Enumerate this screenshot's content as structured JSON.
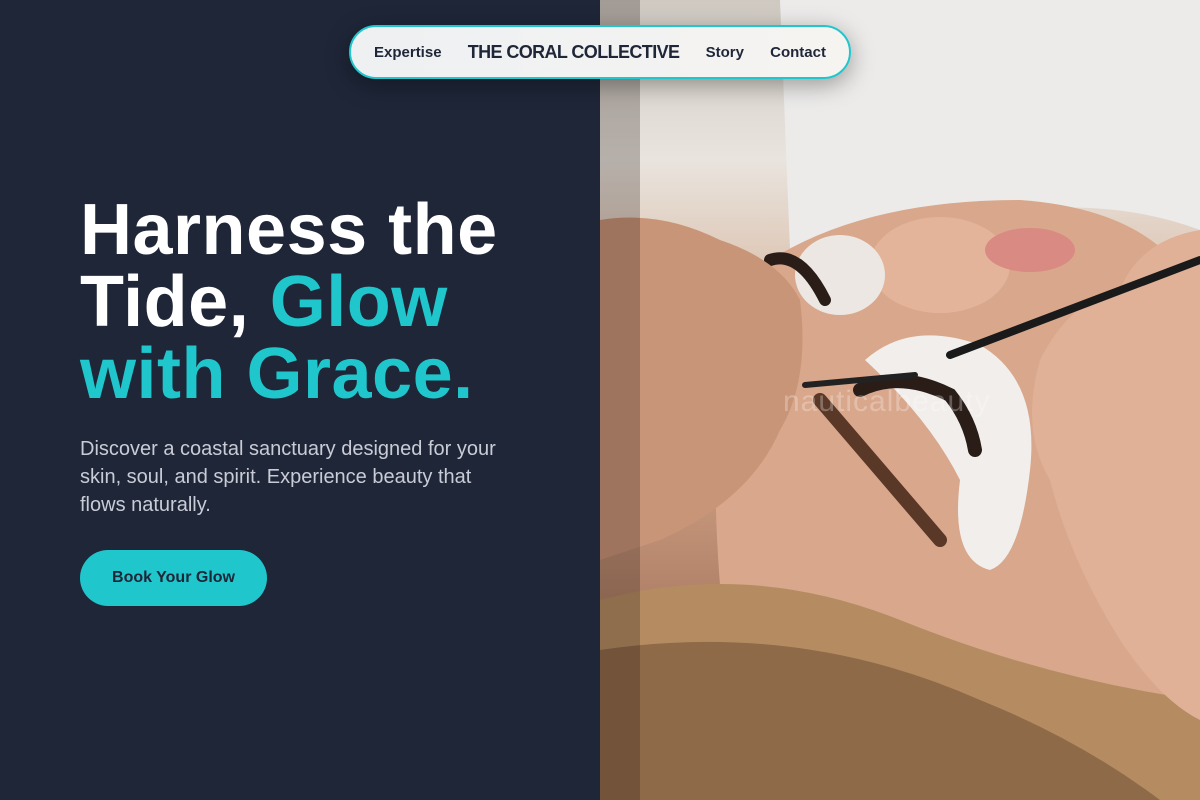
{
  "nav": {
    "left_link": "Expertise",
    "brand": "THE CORAL COLLECTIVE",
    "right_links": [
      "Story",
      "Contact"
    ]
  },
  "hero": {
    "title_line1": "Harness the",
    "title_line2_plain": "Tide, ",
    "title_line2_accent": "Glow",
    "title_line3_accent": "with Grace.",
    "subtitle": "Discover a coastal sanctuary designed for your skin, soul, and spirit. Experience beauty that flows naturally.",
    "cta_label": "Book Your Glow"
  },
  "image": {
    "description_icon": "lash-extension-photo",
    "watermark": "nauticalbeauty"
  },
  "colors": {
    "background": "#1e2638",
    "accent": "#1fc6cc",
    "nav_bg": "#eef0f2",
    "text_light": "#c9ccd6"
  }
}
